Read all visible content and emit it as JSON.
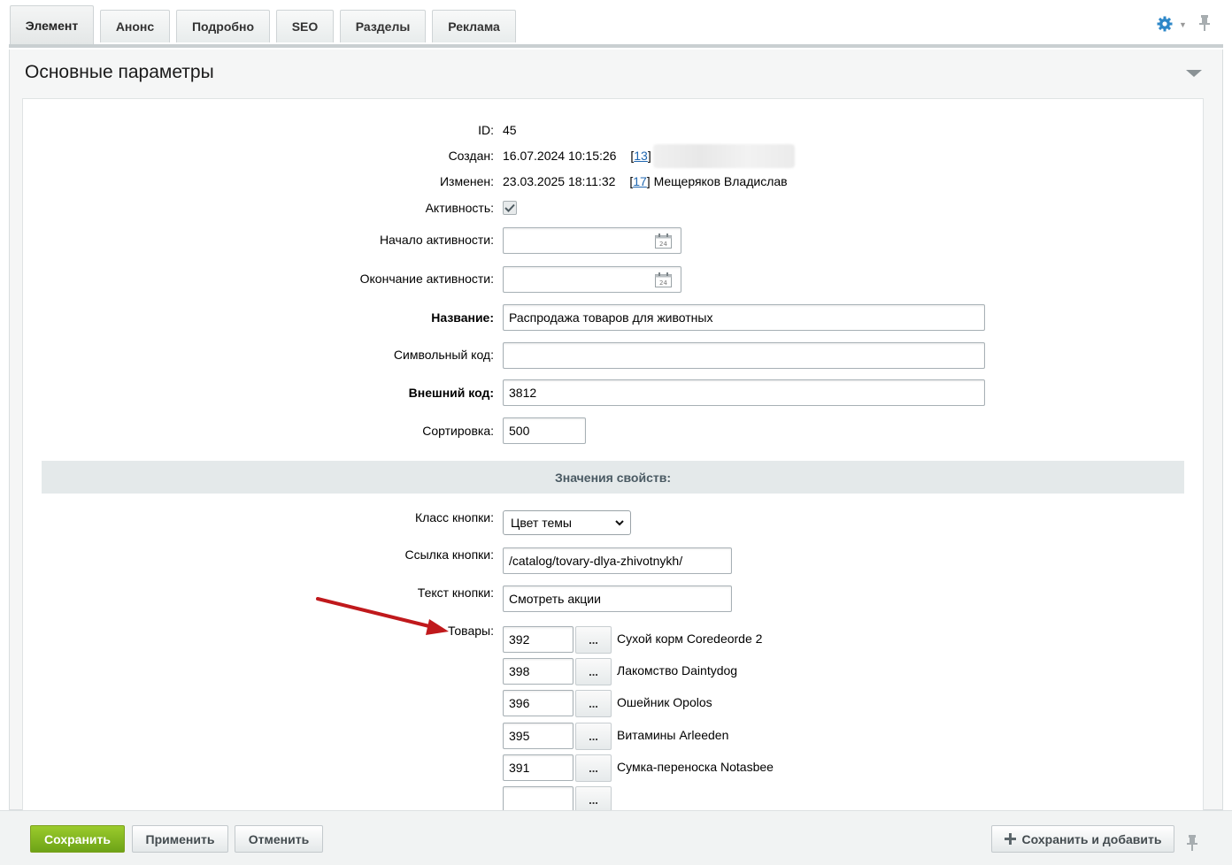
{
  "tabs": [
    {
      "label": "Элемент",
      "active": true
    },
    {
      "label": "Анонс"
    },
    {
      "label": "Подробно"
    },
    {
      "label": "SEO"
    },
    {
      "label": "Разделы"
    },
    {
      "label": "Реклама"
    }
  ],
  "toolbar": {
    "settings_icon": "gear-icon",
    "pin_icon": "pin-icon"
  },
  "section": {
    "title": "Основные параметры"
  },
  "fields": {
    "id": {
      "label": "ID:",
      "value": "45"
    },
    "created": {
      "label": "Создан:",
      "value": "16.07.2024 10:15:26",
      "user_id": "13",
      "bracket_open": "[",
      "bracket_close": "]"
    },
    "modified": {
      "label": "Изменен:",
      "value": "23.03.2025 18:11:32",
      "user_id": "17",
      "user_name": "Мещеряков Владислав",
      "bracket_open": "[",
      "bracket_close": "]"
    },
    "active": {
      "label": "Активность:",
      "checked": true
    },
    "active_from": {
      "label": "Начало активности:",
      "value": ""
    },
    "active_to": {
      "label": "Окончание активности:",
      "value": ""
    },
    "name": {
      "label": "Название:",
      "value": "Распродажа товаров для животных"
    },
    "code": {
      "label": "Символьный код:",
      "value": ""
    },
    "xml_id": {
      "label": "Внешний код:",
      "value": "3812"
    },
    "sort": {
      "label": "Сортировка:",
      "value": "500"
    }
  },
  "properties": {
    "header": "Значения свойств:",
    "button_class": {
      "label": "Класс кнопки:",
      "value": "Цвет темы"
    },
    "button_link": {
      "label": "Ссылка кнопки:",
      "value": "/catalog/tovary-dlya-zhivotnykh/"
    },
    "button_text": {
      "label": "Текст кнопки:",
      "value": "Смотреть акции"
    },
    "products": {
      "label": "Товары:",
      "browse_label": "...",
      "items": [
        {
          "id": "392",
          "name": "Сухой корм Coredeorde 2"
        },
        {
          "id": "398",
          "name": "Лакомство Daintydog"
        },
        {
          "id": "396",
          "name": "Ошейник Opolos"
        },
        {
          "id": "395",
          "name": "Витамины Arleeden"
        },
        {
          "id": "391",
          "name": "Сумка-переноска Notasbee"
        },
        {
          "id": "",
          "name": ""
        }
      ]
    }
  },
  "footer": {
    "save": "Сохранить",
    "apply": "Применить",
    "cancel": "Отменить",
    "save_and_add": "Сохранить и добавить"
  },
  "colors": {
    "accent_green": "#7fb51f",
    "link_blue": "#2067b0",
    "annotation_red": "#c0191c"
  }
}
